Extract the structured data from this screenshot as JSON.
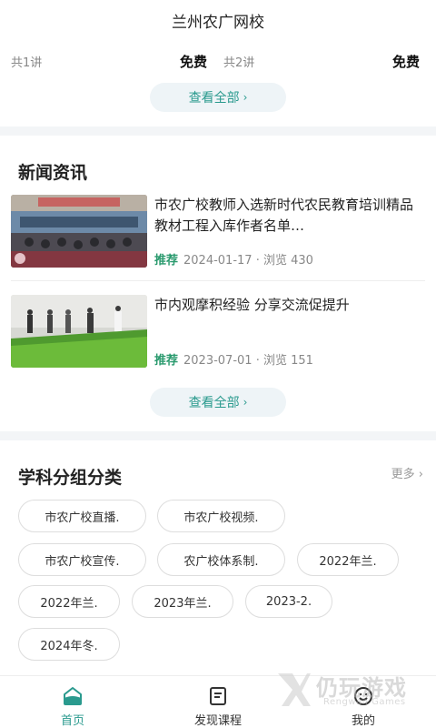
{
  "header": {
    "title": "兰州农广网校"
  },
  "courses": [
    {
      "lessons": "共1讲",
      "price": "免费"
    },
    {
      "lessons": "共2讲",
      "price": "免费"
    }
  ],
  "courses_view_all": "查看全部",
  "news": {
    "title": "新闻资讯",
    "items": [
      {
        "title": "市农广校教师入选新时代农民教育培训精品教材工程入库作者名单…",
        "tag": "推荐",
        "date": "2024-01-17",
        "views": "· 浏览 430"
      },
      {
        "title": "市内观摩积经验 分享交流促提升",
        "tag": "推荐",
        "date": "2023-07-01",
        "views": "· 浏览 151"
      }
    ],
    "view_all": "查看全部"
  },
  "subjects": {
    "title": "学科分组分类",
    "more": "更多",
    "chips": [
      "市农广校直播.",
      "市农广校视频.",
      "市农广校宣传.",
      "农广校体系制.",
      "2022年兰.",
      "2022年兰.",
      "2023年兰.",
      "2023-2.",
      "2024年冬."
    ]
  },
  "tabbar": {
    "items": [
      {
        "label": "首页",
        "icon": "home-icon",
        "active": true
      },
      {
        "label": "发现课程",
        "icon": "book-icon",
        "active": false
      },
      {
        "label": "我的",
        "icon": "smile-icon",
        "active": false
      }
    ]
  },
  "watermark": {
    "cn": "仍玩游戏",
    "en": "Rengwan Games"
  },
  "colors": {
    "accent": "#2a9a8e",
    "tag_green": "#2a9a6e",
    "divider": "#f3f5f7"
  }
}
